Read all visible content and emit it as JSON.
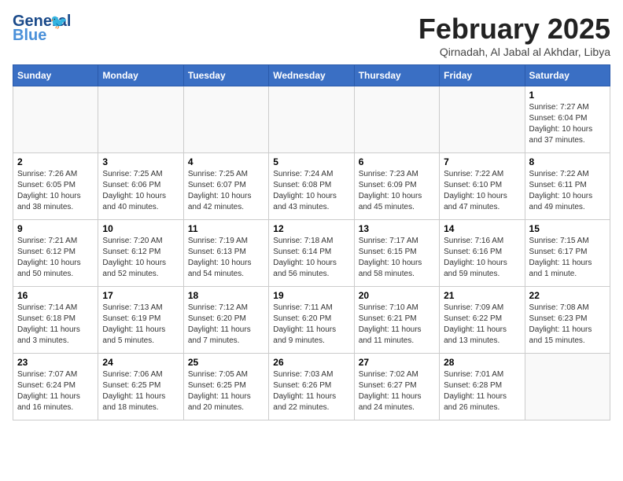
{
  "header": {
    "logo_general": "General",
    "logo_blue": "Blue",
    "month_title": "February 2025",
    "subtitle": "Qirnadah, Al Jabal al Akhdar, Libya"
  },
  "days_of_week": [
    "Sunday",
    "Monday",
    "Tuesday",
    "Wednesday",
    "Thursday",
    "Friday",
    "Saturday"
  ],
  "weeks": [
    [
      {
        "day": "",
        "info": ""
      },
      {
        "day": "",
        "info": ""
      },
      {
        "day": "",
        "info": ""
      },
      {
        "day": "",
        "info": ""
      },
      {
        "day": "",
        "info": ""
      },
      {
        "day": "",
        "info": ""
      },
      {
        "day": "1",
        "info": "Sunrise: 7:27 AM\nSunset: 6:04 PM\nDaylight: 10 hours and 37 minutes."
      }
    ],
    [
      {
        "day": "2",
        "info": "Sunrise: 7:26 AM\nSunset: 6:05 PM\nDaylight: 10 hours and 38 minutes."
      },
      {
        "day": "3",
        "info": "Sunrise: 7:25 AM\nSunset: 6:06 PM\nDaylight: 10 hours and 40 minutes."
      },
      {
        "day": "4",
        "info": "Sunrise: 7:25 AM\nSunset: 6:07 PM\nDaylight: 10 hours and 42 minutes."
      },
      {
        "day": "5",
        "info": "Sunrise: 7:24 AM\nSunset: 6:08 PM\nDaylight: 10 hours and 43 minutes."
      },
      {
        "day": "6",
        "info": "Sunrise: 7:23 AM\nSunset: 6:09 PM\nDaylight: 10 hours and 45 minutes."
      },
      {
        "day": "7",
        "info": "Sunrise: 7:22 AM\nSunset: 6:10 PM\nDaylight: 10 hours and 47 minutes."
      },
      {
        "day": "8",
        "info": "Sunrise: 7:22 AM\nSunset: 6:11 PM\nDaylight: 10 hours and 49 minutes."
      }
    ],
    [
      {
        "day": "9",
        "info": "Sunrise: 7:21 AM\nSunset: 6:12 PM\nDaylight: 10 hours and 50 minutes."
      },
      {
        "day": "10",
        "info": "Sunrise: 7:20 AM\nSunset: 6:12 PM\nDaylight: 10 hours and 52 minutes."
      },
      {
        "day": "11",
        "info": "Sunrise: 7:19 AM\nSunset: 6:13 PM\nDaylight: 10 hours and 54 minutes."
      },
      {
        "day": "12",
        "info": "Sunrise: 7:18 AM\nSunset: 6:14 PM\nDaylight: 10 hours and 56 minutes."
      },
      {
        "day": "13",
        "info": "Sunrise: 7:17 AM\nSunset: 6:15 PM\nDaylight: 10 hours and 58 minutes."
      },
      {
        "day": "14",
        "info": "Sunrise: 7:16 AM\nSunset: 6:16 PM\nDaylight: 10 hours and 59 minutes."
      },
      {
        "day": "15",
        "info": "Sunrise: 7:15 AM\nSunset: 6:17 PM\nDaylight: 11 hours and 1 minute."
      }
    ],
    [
      {
        "day": "16",
        "info": "Sunrise: 7:14 AM\nSunset: 6:18 PM\nDaylight: 11 hours and 3 minutes."
      },
      {
        "day": "17",
        "info": "Sunrise: 7:13 AM\nSunset: 6:19 PM\nDaylight: 11 hours and 5 minutes."
      },
      {
        "day": "18",
        "info": "Sunrise: 7:12 AM\nSunset: 6:20 PM\nDaylight: 11 hours and 7 minutes."
      },
      {
        "day": "19",
        "info": "Sunrise: 7:11 AM\nSunset: 6:20 PM\nDaylight: 11 hours and 9 minutes."
      },
      {
        "day": "20",
        "info": "Sunrise: 7:10 AM\nSunset: 6:21 PM\nDaylight: 11 hours and 11 minutes."
      },
      {
        "day": "21",
        "info": "Sunrise: 7:09 AM\nSunset: 6:22 PM\nDaylight: 11 hours and 13 minutes."
      },
      {
        "day": "22",
        "info": "Sunrise: 7:08 AM\nSunset: 6:23 PM\nDaylight: 11 hours and 15 minutes."
      }
    ],
    [
      {
        "day": "23",
        "info": "Sunrise: 7:07 AM\nSunset: 6:24 PM\nDaylight: 11 hours and 16 minutes."
      },
      {
        "day": "24",
        "info": "Sunrise: 7:06 AM\nSunset: 6:25 PM\nDaylight: 11 hours and 18 minutes."
      },
      {
        "day": "25",
        "info": "Sunrise: 7:05 AM\nSunset: 6:25 PM\nDaylight: 11 hours and 20 minutes."
      },
      {
        "day": "26",
        "info": "Sunrise: 7:03 AM\nSunset: 6:26 PM\nDaylight: 11 hours and 22 minutes."
      },
      {
        "day": "27",
        "info": "Sunrise: 7:02 AM\nSunset: 6:27 PM\nDaylight: 11 hours and 24 minutes."
      },
      {
        "day": "28",
        "info": "Sunrise: 7:01 AM\nSunset: 6:28 PM\nDaylight: 11 hours and 26 minutes."
      },
      {
        "day": "",
        "info": ""
      }
    ]
  ]
}
